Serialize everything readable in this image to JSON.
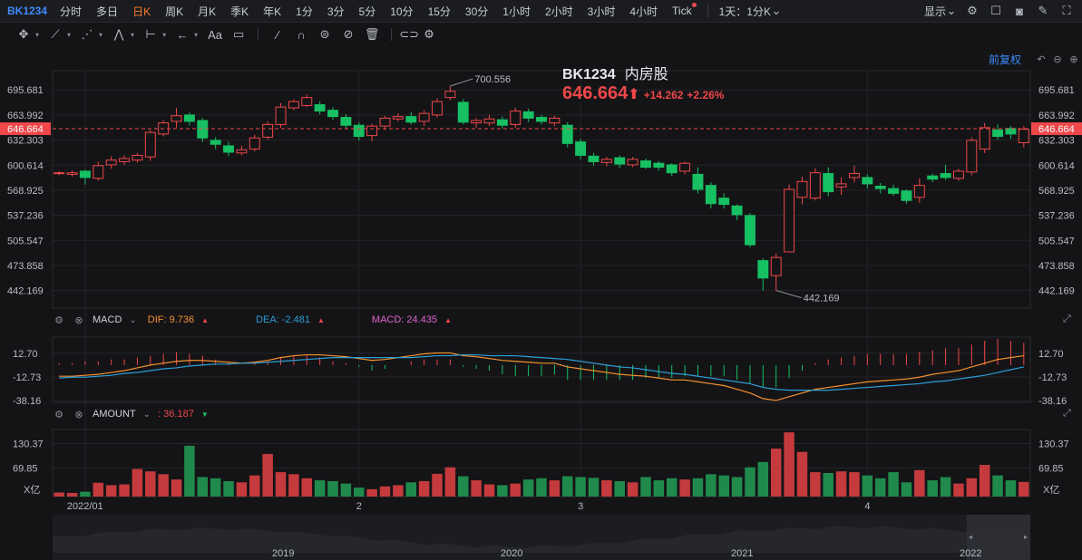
{
  "toolbar": {
    "symbol": "BK1234",
    "timeframes": [
      "分时",
      "多日",
      "日K",
      "周K",
      "月K",
      "季K",
      "年K",
      "1分",
      "3分",
      "5分",
      "10分",
      "15分",
      "30分",
      "1小时",
      "2小时",
      "3小时",
      "4小时",
      "Tick"
    ],
    "active_timeframe": "日K",
    "range_selector": "1天：1分K",
    "display_label": "显示"
  },
  "quote": {
    "code": "BK1234",
    "name": "内房股",
    "price": "646.664",
    "change": "+14.262",
    "change_pct": "+2.26%",
    "restore_label": "前复权"
  },
  "colors": {
    "up": "#f0474a",
    "down": "#16c063",
    "dif": "#f5902b",
    "dea": "#2b9fd9",
    "macd": "#e060d0",
    "accent": "#3d8bff"
  },
  "chart_data": [
    {
      "type": "candlestick",
      "y_ticks": [
        "695.681",
        "663.992",
        "632.303",
        "600.614",
        "568.925",
        "537.236",
        "505.547",
        "473.858",
        "442.169"
      ],
      "ylim": [
        420.0,
        720.0
      ],
      "current_price_label": "646.664",
      "high_annotation": "700.556",
      "low_annotation": "442.169",
      "x_labels": [
        "2022/01",
        "2",
        "3",
        "4"
      ],
      "candles": [
        [
          591,
          591,
          588,
          593
        ],
        [
          589,
          591,
          586,
          594
        ],
        [
          593,
          585,
          576,
          595
        ],
        [
          584,
          600,
          581,
          605
        ],
        [
          601,
          607,
          596,
          612
        ],
        [
          605,
          609,
          601,
          613
        ],
        [
          607,
          613,
          604,
          616
        ],
        [
          611,
          642,
          606,
          645
        ],
        [
          640,
          654,
          637,
          657
        ],
        [
          656,
          663,
          648,
          673
        ],
        [
          664,
          656,
          651,
          667
        ],
        [
          657,
          635,
          630,
          660
        ],
        [
          632,
          627,
          621,
          636
        ],
        [
          625,
          617,
          612,
          630
        ],
        [
          616,
          620,
          613,
          625
        ],
        [
          621,
          635,
          618,
          639
        ],
        [
          636,
          652,
          633,
          656
        ],
        [
          652,
          674,
          648,
          679
        ],
        [
          673,
          681,
          670,
          684
        ],
        [
          676,
          686,
          674,
          690
        ],
        [
          677,
          669,
          665,
          681
        ],
        [
          670,
          662,
          658,
          674
        ],
        [
          661,
          651,
          647,
          665
        ],
        [
          651,
          637,
          632,
          655
        ],
        [
          638,
          650,
          631,
          653
        ],
        [
          650,
          660,
          645,
          663
        ],
        [
          659,
          662,
          656,
          666
        ],
        [
          662,
          655,
          652,
          668
        ],
        [
          656,
          666,
          650,
          670
        ],
        [
          664,
          681,
          661,
          685
        ],
        [
          686,
          694,
          683,
          700.556
        ],
        [
          680,
          655,
          652,
          684
        ],
        [
          654,
          657,
          648,
          660
        ],
        [
          654,
          659,
          650,
          664
        ],
        [
          658,
          651,
          647,
          662
        ],
        [
          652,
          669,
          648,
          673
        ],
        [
          668,
          660,
          655,
          672
        ],
        [
          661,
          656,
          652,
          664
        ],
        [
          654,
          660,
          650,
          663
        ],
        [
          651,
          628,
          623,
          655
        ],
        [
          630,
          613,
          608,
          634
        ],
        [
          612,
          605,
          600,
          616
        ],
        [
          604,
          608,
          599,
          611
        ],
        [
          610,
          602,
          597,
          613
        ],
        [
          601,
          608,
          598,
          611
        ],
        [
          606,
          598,
          596,
          609
        ],
        [
          603,
          598,
          594,
          606
        ],
        [
          601,
          591,
          587,
          603
        ],
        [
          593,
          603,
          589,
          605
        ],
        [
          589,
          570,
          565,
          598
        ],
        [
          575,
          552,
          546,
          579
        ],
        [
          559,
          551,
          546,
          565
        ],
        [
          549,
          538,
          531,
          551
        ],
        [
          537,
          500,
          497,
          540
        ],
        [
          480,
          458,
          442.169,
          483
        ],
        [
          461,
          484,
          442.169,
          489
        ],
        [
          491,
          570,
          540,
          576
        ],
        [
          560,
          580,
          551,
          586
        ],
        [
          559,
          591,
          556,
          597
        ],
        [
          590,
          567,
          561,
          598
        ],
        [
          573,
          577,
          563,
          585
        ],
        [
          585,
          590,
          579,
          600
        ],
        [
          585,
          577,
          571,
          589
        ],
        [
          574,
          571,
          565,
          578
        ],
        [
          571,
          565,
          562,
          576
        ],
        [
          568,
          556,
          552,
          570
        ],
        [
          560,
          575,
          553,
          584
        ],
        [
          587,
          583,
          579,
          590
        ],
        [
          590,
          585,
          582,
          601
        ],
        [
          584,
          593,
          581,
          596
        ],
        [
          592,
          632,
          588,
          636
        ],
        [
          621,
          648,
          616,
          654
        ],
        [
          645,
          637,
          633,
          652
        ],
        [
          647,
          640,
          634,
          650
        ],
        [
          629,
          646,
          623,
          650
        ]
      ]
    },
    {
      "type": "line",
      "name": "MACD",
      "title": "MACD",
      "dif_label": "DIF: 9.736",
      "dea_label": "DEA: -2.481",
      "macd_label": "MACD: 24.435",
      "y_ticks": [
        "12.70",
        "-12.73",
        "-38.16"
      ],
      "ylim": [
        -40,
        30
      ],
      "series": [
        {
          "name": "DIF",
          "values": [
            -12,
            -12,
            -11,
            -10,
            -8,
            -6,
            -3,
            0,
            2,
            4,
            5,
            5,
            4,
            3,
            2,
            3,
            5,
            8,
            10,
            11,
            11,
            10,
            9,
            7,
            5,
            6,
            8,
            10,
            12,
            13,
            13,
            10,
            9,
            7,
            5,
            4,
            3,
            2,
            2,
            -2,
            -4,
            -6,
            -8,
            -10,
            -11,
            -12,
            -14,
            -16,
            -16,
            -18,
            -20,
            -22,
            -26,
            -30,
            -36,
            -38,
            -34,
            -30,
            -26,
            -24,
            -22,
            -20,
            -18,
            -17,
            -16,
            -15,
            -13,
            -10,
            -8,
            -6,
            -2,
            2,
            6,
            8,
            10
          ]
        },
        {
          "name": "DEA",
          "values": [
            -14,
            -13,
            -13,
            -12,
            -11,
            -9,
            -8,
            -6,
            -4,
            -3,
            -1,
            0,
            1,
            1,
            2,
            2,
            3,
            4,
            5,
            6,
            7,
            8,
            8,
            8,
            8,
            8,
            8,
            8,
            9,
            10,
            10,
            11,
            11,
            10,
            10,
            10,
            9,
            8,
            7,
            6,
            4,
            2,
            0,
            -2,
            -3,
            -5,
            -7,
            -9,
            -10,
            -12,
            -14,
            -16,
            -18,
            -20,
            -24,
            -26,
            -27,
            -27,
            -27,
            -27,
            -26,
            -25,
            -24,
            -23,
            -22,
            -21,
            -20,
            -18,
            -17,
            -15,
            -13,
            -11,
            -8,
            -5,
            -2
          ]
        },
        {
          "name": "MACD",
          "values": [
            2,
            2,
            4,
            4,
            6,
            6,
            8,
            10,
            12,
            14,
            12,
            10,
            6,
            4,
            0,
            2,
            4,
            8,
            10,
            10,
            8,
            4,
            2,
            -2,
            -6,
            -4,
            0,
            4,
            6,
            6,
            6,
            -2,
            -4,
            -6,
            -10,
            -12,
            -12,
            -12,
            -10,
            -16,
            -16,
            -16,
            -16,
            -16,
            -16,
            -14,
            -14,
            -14,
            -12,
            -12,
            -12,
            -12,
            -16,
            -20,
            -24,
            -24,
            -14,
            -6,
            2,
            6,
            8,
            10,
            12,
            12,
            12,
            12,
            14,
            16,
            18,
            18,
            22,
            26,
            28,
            26,
            24
          ]
        }
      ]
    },
    {
      "type": "bar",
      "name": "AMOUNT",
      "title": "AMOUNT",
      "value_label": ": 36.187",
      "y_ticks": [
        "130.37",
        "69.85"
      ],
      "unit_label": "X亿",
      "ylim": [
        0,
        165
      ],
      "values": [
        10,
        9,
        12,
        34,
        28,
        30,
        68,
        62,
        55,
        42,
        125,
        48,
        45,
        38,
        35,
        52,
        105,
        60,
        55,
        45,
        40,
        38,
        32,
        22,
        18,
        25,
        28,
        35,
        38,
        56,
        72,
        50,
        40,
        30,
        28,
        32,
        42,
        45,
        40,
        50,
        48,
        46,
        40,
        38,
        35,
        48,
        40,
        45,
        42,
        45,
        55,
        52,
        48,
        72,
        85,
        118,
        158,
        110,
        60,
        58,
        62,
        60,
        52,
        45,
        60,
        35,
        65,
        40,
        48,
        32,
        45,
        78,
        52,
        40,
        36
      ]
    }
  ],
  "time_axis": {
    "x_labels": [
      "2019",
      "2020",
      "2021",
      "2022"
    ]
  },
  "panels": {
    "macd_name": "MACD",
    "amount_name": "AMOUNT"
  }
}
